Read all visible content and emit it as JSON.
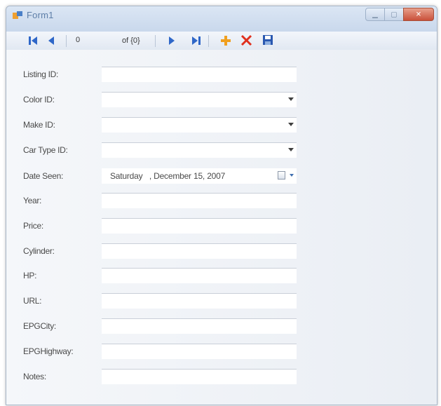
{
  "window": {
    "title": "Form1"
  },
  "navigator": {
    "position_value": "0",
    "count_label": "of {0}"
  },
  "fields": [
    {
      "label": "Listing ID:",
      "type": "text",
      "value": ""
    },
    {
      "label": "Color ID:",
      "type": "combo",
      "value": ""
    },
    {
      "label": "Make ID:",
      "type": "combo",
      "value": ""
    },
    {
      "label": "Car Type ID:",
      "type": "combo",
      "value": ""
    },
    {
      "label": "Date Seen:",
      "type": "date",
      "value": "Saturday   , December 15, 2007"
    },
    {
      "label": "Year:",
      "type": "text",
      "value": ""
    },
    {
      "label": "Price:",
      "type": "text",
      "value": ""
    },
    {
      "label": "Cylinder:",
      "type": "text",
      "value": ""
    },
    {
      "label": "HP:",
      "type": "text",
      "value": ""
    },
    {
      "label": "URL:",
      "type": "text",
      "value": ""
    },
    {
      "label": "EPGCity:",
      "type": "text",
      "value": ""
    },
    {
      "label": "EPGHighway:",
      "type": "text",
      "value": ""
    },
    {
      "label": "Notes:",
      "type": "text",
      "value": ""
    }
  ],
  "colors": {
    "accent_blue": "#2f67c8",
    "delete_red": "#e0301e",
    "add_orange": "#f0a020"
  },
  "icons": [
    "move-first-icon",
    "move-previous-icon",
    "move-next-icon",
    "move-last-icon",
    "add-new-icon",
    "delete-icon",
    "save-icon"
  ]
}
